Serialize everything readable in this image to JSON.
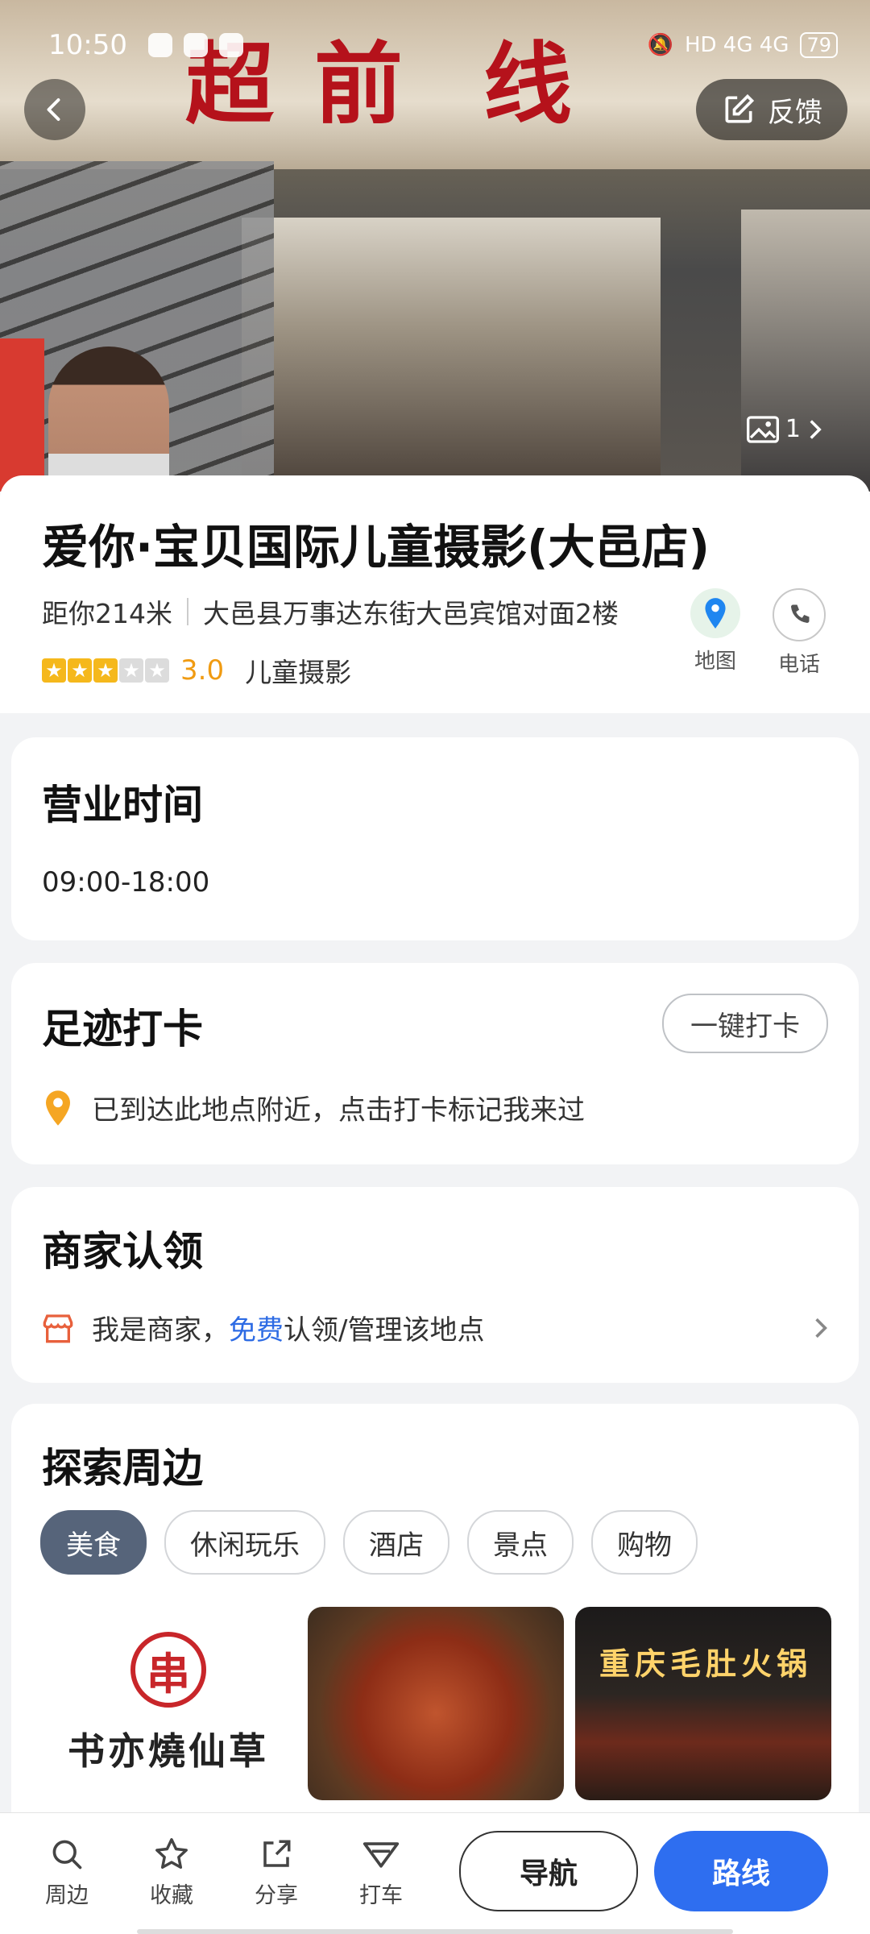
{
  "status_bar": {
    "time": "10:50",
    "network": "HD 4G 4G",
    "battery": "79"
  },
  "header": {
    "feedback_label": "反馈",
    "photo_count": "1"
  },
  "hero": {
    "sign_chars": [
      "超",
      "前",
      "线"
    ]
  },
  "poi": {
    "name": "爱你·宝贝国际儿童摄影(大邑店)",
    "distance": "距你214米",
    "address": "大邑县万事达东街大邑宾馆对面2楼",
    "rating": "3.0",
    "rating_value": 3,
    "category": "儿童摄影",
    "map_label": "地图",
    "phone_label": "电话"
  },
  "hours": {
    "title": "营业时间",
    "value": "09:00-18:00"
  },
  "checkin": {
    "title": "足迹打卡",
    "button": "一键打卡",
    "hint": "已到达此地点附近，点击打卡标记我来过"
  },
  "merchant": {
    "title": "商家认领",
    "prefix": "我是商家，",
    "free": "免费",
    "suffix": "认领/管理该地点"
  },
  "explore": {
    "title": "探索周边",
    "chips": [
      "美食",
      "休闲玩乐",
      "酒店",
      "景点",
      "购物"
    ],
    "logo_name": "书亦燒仙草",
    "neon_text": "重庆毛肚火锅"
  },
  "bottom": {
    "tabs": [
      "周边",
      "收藏",
      "分享",
      "打车"
    ],
    "nav_label": "导航",
    "route_label": "路线"
  },
  "colors": {
    "accent": "#2e6ef0",
    "star": "#f5b81c",
    "score": "#f09b12",
    "chip_active": "#56647a"
  }
}
